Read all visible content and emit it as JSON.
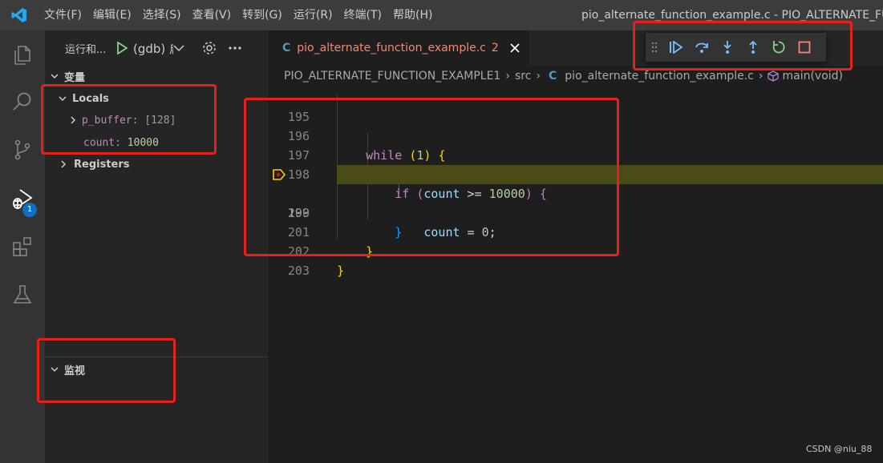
{
  "menu": [
    "文件(F)",
    "编辑(E)",
    "选择(S)",
    "查看(V)",
    "转到(G)",
    "运行(R)",
    "终端(T)",
    "帮助(H)"
  ],
  "window_title": "pio_alternate_function_example.c - PIO_ALTERNATE_FUNC",
  "activity": {
    "items": [
      "explorer-icon",
      "search-icon",
      "source-control-icon",
      "run-debug-icon",
      "extensions-icon",
      "testing-icon"
    ],
    "debug_badge": "1"
  },
  "sidebar": {
    "title": "运行和...",
    "launch_config": "(gdb) 启",
    "variables_header": "变量",
    "locals_header": "Locals",
    "locals": [
      {
        "name": "p_buffer",
        "value": "[128]",
        "expandable": true
      },
      {
        "name": "count",
        "value": "10000",
        "expandable": false
      }
    ],
    "registers_header": "Registers",
    "watch_header": "监视"
  },
  "editor": {
    "tab": {
      "lang_icon": "C",
      "filename": "pio_alternate_function_example.c",
      "problems": "2"
    },
    "breadcrumb": {
      "project": "PIO_ALTERNATE_FUNCTION_EXAMPLE1",
      "folder": "src",
      "lang_icon": "C",
      "file": "pio_alternate_function_example.c",
      "symbol": "main(void)"
    },
    "current_line": "199",
    "lines": [
      {
        "num": "195",
        "tokens": []
      },
      {
        "num": "196",
        "tokens": [
          [
            "kw",
            "    while "
          ],
          [
            "br1",
            "("
          ],
          [
            "num",
            "1"
          ],
          [
            "br1",
            ")"
          ],
          [
            "op",
            " "
          ],
          [
            "br1",
            "{"
          ]
        ]
      },
      {
        "num": "197",
        "tokens": [
          [
            "id",
            "        count"
          ],
          [
            "op",
            "++;"
          ]
        ]
      },
      {
        "num": "198",
        "tokens": [
          [
            "kw",
            "        if "
          ],
          [
            "br2",
            "("
          ],
          [
            "id",
            "count"
          ],
          [
            "op",
            " >= "
          ],
          [
            "num",
            "10000"
          ],
          [
            "br2",
            ")"
          ],
          [
            "op",
            " "
          ],
          [
            "br2",
            "{"
          ]
        ]
      },
      {
        "num": "199",
        "tokens": [
          [
            "id",
            "            count"
          ],
          [
            "op",
            " = "
          ],
          [
            "num",
            "0"
          ],
          [
            "op",
            ";"
          ]
        ]
      },
      {
        "num": "200",
        "tokens": [
          [
            "br3",
            "        }"
          ]
        ]
      },
      {
        "num": "201",
        "tokens": [
          [
            "br1",
            "    }"
          ]
        ]
      },
      {
        "num": "202",
        "tokens": [
          [
            "br1",
            "}"
          ]
        ]
      },
      {
        "num": "203",
        "tokens": []
      }
    ]
  },
  "debug_toolbar": [
    "drag-handle-icon",
    "continue-icon",
    "step-over-icon",
    "step-into-icon",
    "step-out-icon",
    "restart-icon",
    "stop-icon"
  ],
  "watermark": "CSDN @niu_88",
  "colors": {
    "annotation": "#e8201c",
    "accent": "#0e70c0",
    "current_line": "#4b4b18"
  }
}
